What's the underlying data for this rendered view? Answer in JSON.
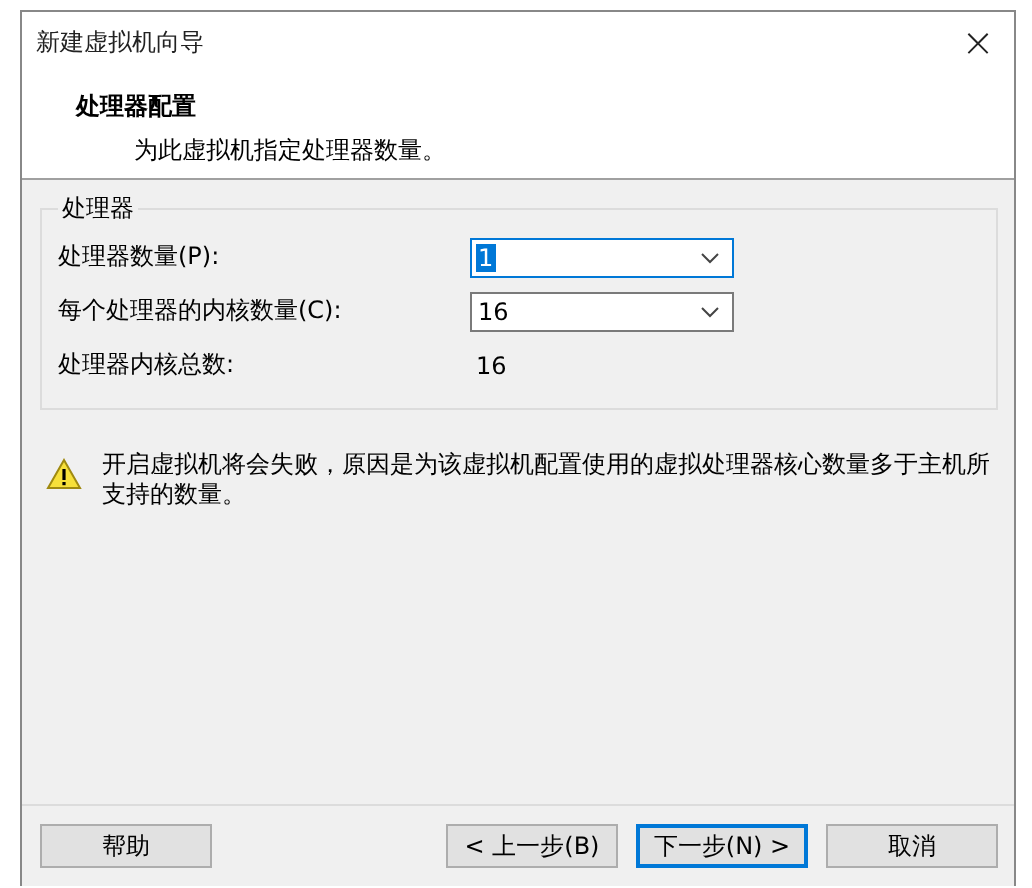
{
  "window": {
    "title": "新建虚拟机向导",
    "close": "×"
  },
  "header": {
    "title": "处理器配置",
    "subtitle": "为此虚拟机指定处理器数量。"
  },
  "group": {
    "legend": "处理器",
    "rows": [
      {
        "kind": "combo",
        "label": "处理器数量(P):",
        "value": "1",
        "focused": true
      },
      {
        "kind": "combo",
        "label": "每个处理器的内核数量(C):",
        "value": "16",
        "focused": false
      },
      {
        "kind": "text",
        "label": "处理器内核总数:",
        "value": "16"
      }
    ]
  },
  "warning": {
    "text": "开启虚拟机将会失败，原因是为该虚拟机配置使用的虚拟处理器核心数量多于主机所支持的数量。"
  },
  "buttons": [
    {
      "label": "帮助",
      "kind": "help",
      "default": false
    },
    {
      "label": "< 上一步(B)",
      "kind": "nav",
      "default": false
    },
    {
      "label": "下一步(N) >",
      "kind": "nav",
      "default": true
    },
    {
      "label": "取消",
      "kind": "nav",
      "default": false
    }
  ]
}
